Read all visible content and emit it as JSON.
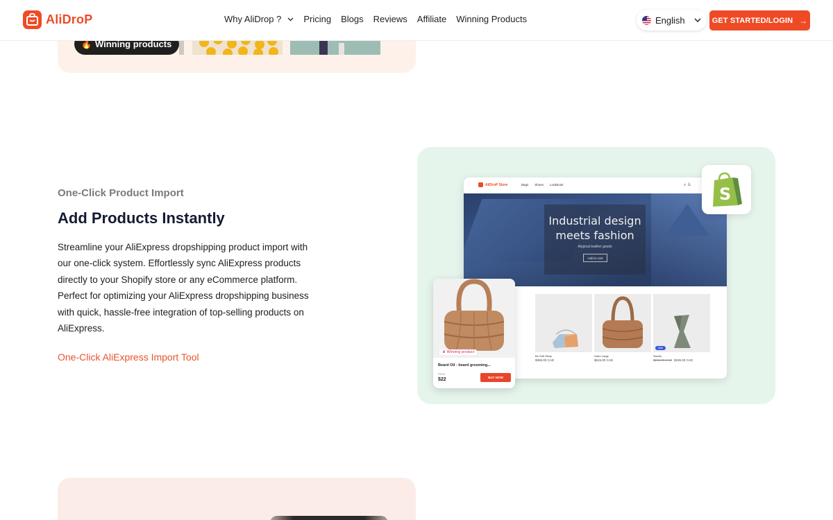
{
  "nav": {
    "brand": "AliDroP",
    "links": [
      "Why AliDrop ?",
      "Pricing",
      "Blogs",
      "Reviews",
      "Affiliate",
      "Winning Products"
    ],
    "language": "English",
    "cta": "GET STARTED/LOGIN"
  },
  "top_card": {
    "badge": "Winning products"
  },
  "feature": {
    "eyebrow": "One-Click Product Import",
    "title": "Add Products Instantly",
    "body": "Streamline your AliExpress dropshipping product import with our one-click system. Effortlessly sync AliExpress products directly to your Shopify store or any eCommerce platform. Perfect for optimizing your AliExpress dropshipping business with quick, hassle-free integration of top-selling products on AliExpress.",
    "link": "One-Click AliExpress Import Tool"
  },
  "mockup": {
    "store_brand": "AliDroP Store",
    "store_menu": [
      "Bags",
      "Shoes",
      "Lookbook"
    ],
    "hero_title": "Industrial design meets fashion",
    "hero_sub": "Atypical leather goods",
    "hero_button": "Add to cart",
    "products": [
      {
        "name": "Bo Soft Strap",
        "price": "$365.00 CAD",
        "old_price": ""
      },
      {
        "name": "Hobo Large",
        "price": "$615.00 CAD",
        "old_price": ""
      },
      {
        "name": "Stuvés",
        "price": "$195.00 CAD",
        "old_price": "$245.00 CAD",
        "badge": "Sale"
      }
    ],
    "featured": {
      "tag": "Winning product",
      "title": "Beard Oil - beard grooming...",
      "price_label": "Price",
      "price": "$22",
      "button": "BUY NOW"
    }
  },
  "colors": {
    "brand": "#ee4b27",
    "link": "#e8542a",
    "mockup_bg": "#e6f5ec",
    "top_card_bg": "#fdf1e9",
    "bottom_card_bg": "#fcece8"
  }
}
